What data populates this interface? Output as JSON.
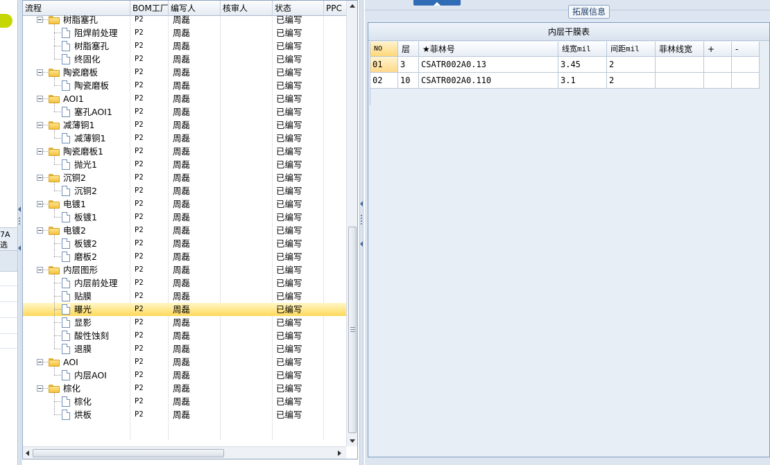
{
  "left_strip": {
    "label_line1": "7A",
    "label_line2": "选"
  },
  "tree": {
    "columns": [
      "流程",
      "BOM工厂",
      "编写人",
      "核审人",
      "状态",
      "PPC"
    ],
    "rows": [
      {
        "level": 1,
        "label": "树脂塞孔",
        "bom": "P2",
        "writer": "周磊",
        "reviewer": "",
        "status": "已编写"
      },
      {
        "level": 2,
        "label": "阻焊前处理",
        "bom": "P2",
        "writer": "周磊",
        "reviewer": "",
        "status": "已编写"
      },
      {
        "level": 2,
        "label": "树脂塞孔",
        "bom": "P2",
        "writer": "周磊",
        "reviewer": "",
        "status": "已编写"
      },
      {
        "level": 2,
        "label": "终固化",
        "bom": "P2",
        "writer": "周磊",
        "reviewer": "",
        "status": "已编写"
      },
      {
        "level": 1,
        "label": "陶瓷磨板",
        "bom": "P2",
        "writer": "周磊",
        "reviewer": "",
        "status": "已编写"
      },
      {
        "level": 2,
        "label": "陶瓷磨板",
        "bom": "P2",
        "writer": "周磊",
        "reviewer": "",
        "status": "已编写"
      },
      {
        "level": 1,
        "label": "AOI1",
        "bom": "P2",
        "writer": "周磊",
        "reviewer": "",
        "status": "已编写"
      },
      {
        "level": 2,
        "label": "塞孔AOI1",
        "bom": "P2",
        "writer": "周磊",
        "reviewer": "",
        "status": "已编写"
      },
      {
        "level": 1,
        "label": "减薄铜1",
        "bom": "P2",
        "writer": "周磊",
        "reviewer": "",
        "status": "已编写"
      },
      {
        "level": 2,
        "label": "减薄铜1",
        "bom": "P2",
        "writer": "周磊",
        "reviewer": "",
        "status": "已编写"
      },
      {
        "level": 1,
        "label": "陶瓷磨板1",
        "bom": "P2",
        "writer": "周磊",
        "reviewer": "",
        "status": "已编写"
      },
      {
        "level": 2,
        "label": "抛光1",
        "bom": "P2",
        "writer": "周磊",
        "reviewer": "",
        "status": "已编写"
      },
      {
        "level": 1,
        "label": "沉铜2",
        "bom": "P2",
        "writer": "周磊",
        "reviewer": "",
        "status": "已编写"
      },
      {
        "level": 2,
        "label": "沉铜2",
        "bom": "P2",
        "writer": "周磊",
        "reviewer": "",
        "status": "已编写"
      },
      {
        "level": 1,
        "label": "电镀1",
        "bom": "P2",
        "writer": "周磊",
        "reviewer": "",
        "status": "已编写"
      },
      {
        "level": 2,
        "label": "板镀1",
        "bom": "P2",
        "writer": "周磊",
        "reviewer": "",
        "status": "已编写"
      },
      {
        "level": 1,
        "label": "电镀2",
        "bom": "P2",
        "writer": "周磊",
        "reviewer": "",
        "status": "已编写"
      },
      {
        "level": 2,
        "label": "板镀2",
        "bom": "P2",
        "writer": "周磊",
        "reviewer": "",
        "status": "已编写"
      },
      {
        "level": 2,
        "label": "磨板2",
        "bom": "P2",
        "writer": "周磊",
        "reviewer": "",
        "status": "已编写"
      },
      {
        "level": 1,
        "label": "内层图形",
        "bom": "P2",
        "writer": "周磊",
        "reviewer": "",
        "status": "已编写"
      },
      {
        "level": 2,
        "label": "内层前处理",
        "bom": "P2",
        "writer": "周磊",
        "reviewer": "",
        "status": "已编写"
      },
      {
        "level": 2,
        "label": "贴膜",
        "bom": "P2",
        "writer": "周磊",
        "reviewer": "",
        "status": "已编写"
      },
      {
        "level": 2,
        "label": "曝光",
        "bom": "P2",
        "writer": "周磊",
        "reviewer": "",
        "status": "已编写",
        "selected": true
      },
      {
        "level": 2,
        "label": "显影",
        "bom": "P2",
        "writer": "周磊",
        "reviewer": "",
        "status": "已编写"
      },
      {
        "level": 2,
        "label": "酸性蚀刻",
        "bom": "P2",
        "writer": "周磊",
        "reviewer": "",
        "status": "已编写"
      },
      {
        "level": 2,
        "label": "退膜",
        "bom": "P2",
        "writer": "周磊",
        "reviewer": "",
        "status": "已编写"
      },
      {
        "level": 1,
        "label": "AOI",
        "bom": "P2",
        "writer": "周磊",
        "reviewer": "",
        "status": "已编写"
      },
      {
        "level": 2,
        "label": "内层AOI",
        "bom": "P2",
        "writer": "周磊",
        "reviewer": "",
        "status": "已编写"
      },
      {
        "level": 1,
        "label": "棕化",
        "bom": "P2",
        "writer": "周磊",
        "reviewer": "",
        "status": "已编写"
      },
      {
        "level": 2,
        "label": "棕化",
        "bom": "P2",
        "writer": "周磊",
        "reviewer": "",
        "status": "已编写"
      },
      {
        "level": 2,
        "label": "烘板",
        "bom": "P2",
        "writer": "周磊",
        "reviewer": "",
        "status": "已编写"
      }
    ]
  },
  "right_panel": {
    "tab_label": "拓展信息",
    "table_title": "内层干膜表",
    "columns": [
      "NO",
      "层",
      "★菲林号",
      "线宽mil",
      "间距mil",
      "菲林线宽",
      "+",
      "-"
    ],
    "rows": [
      {
        "no": "01",
        "layer": "3",
        "film_no": "CSATR002A0.13",
        "line_width": "3.45",
        "spacing": "2",
        "film_line_width": "",
        "selected": true
      },
      {
        "no": "02",
        "layer": "10",
        "film_no": "CSATR002A0.110",
        "line_width": "3.1",
        "spacing": "2",
        "film_line_width": ""
      }
    ]
  },
  "colors": {
    "selection": "#ffd95a",
    "accent": "#2f6cb5",
    "panel_bg": "#dde6f0"
  }
}
